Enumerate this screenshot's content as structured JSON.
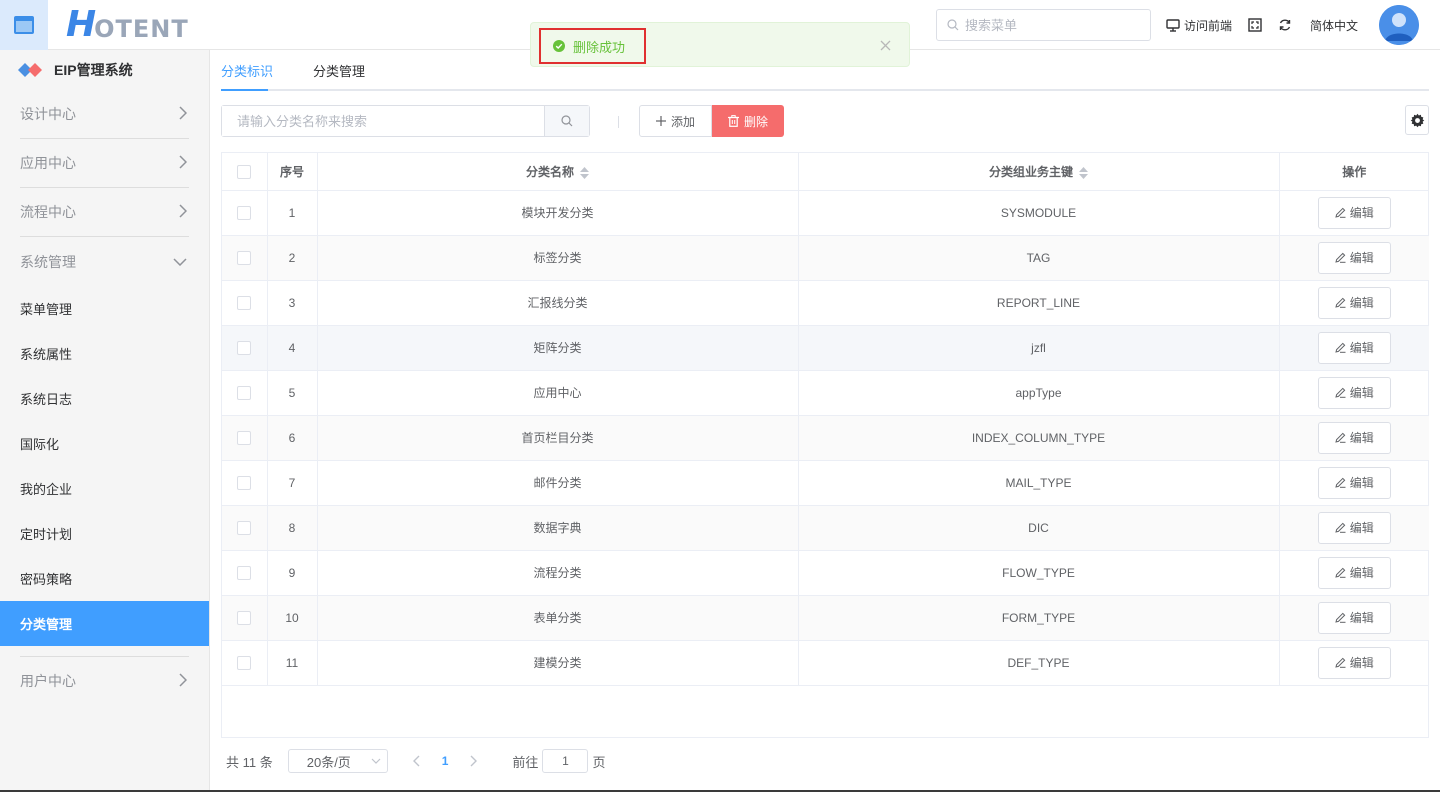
{
  "header": {
    "logo_big": "H",
    "logo_rest": "OTENT",
    "search_placeholder": "搜索菜单",
    "visit_frontend": "访问前端",
    "language": "简体中文"
  },
  "toast": {
    "message": "删除成功"
  },
  "sidebar": {
    "system_title": "EIP管理系统",
    "groups_top": [
      {
        "label": "设计中心"
      },
      {
        "label": "应用中心"
      },
      {
        "label": "流程中心"
      }
    ],
    "expanded_group": "系统管理",
    "items": [
      {
        "label": "菜单管理"
      },
      {
        "label": "系统属性"
      },
      {
        "label": "系统日志"
      },
      {
        "label": "国际化"
      },
      {
        "label": "我的企业"
      },
      {
        "label": "定时计划"
      },
      {
        "label": "密码策略"
      },
      {
        "label": "分类管理"
      }
    ],
    "bottom_group": "用户中心"
  },
  "tabs": [
    {
      "label": "分类标识"
    },
    {
      "label": "分类管理"
    }
  ],
  "toolbar": {
    "search_placeholder": "请输入分类名称来搜索",
    "add_label": "添加",
    "delete_label": "删除"
  },
  "table": {
    "headers": {
      "index": "序号",
      "name": "分类名称",
      "key": "分类组业务主键",
      "action": "操作"
    },
    "edit_label": "编辑",
    "rows": [
      {
        "index": "1",
        "name": "模块开发分类",
        "key": "SYSMODULE"
      },
      {
        "index": "2",
        "name": "标签分类",
        "key": "TAG"
      },
      {
        "index": "3",
        "name": "汇报线分类",
        "key": "REPORT_LINE"
      },
      {
        "index": "4",
        "name": "矩阵分类",
        "key": "jzfl"
      },
      {
        "index": "5",
        "name": "应用中心",
        "key": "appType"
      },
      {
        "index": "6",
        "name": "首页栏目分类",
        "key": "INDEX_COLUMN_TYPE"
      },
      {
        "index": "7",
        "name": "邮件分类",
        "key": "MAIL_TYPE"
      },
      {
        "index": "8",
        "name": "数据字典",
        "key": "DIC"
      },
      {
        "index": "9",
        "name": "流程分类",
        "key": "FLOW_TYPE"
      },
      {
        "index": "10",
        "name": "表单分类",
        "key": "FORM_TYPE"
      },
      {
        "index": "11",
        "name": "建模分类",
        "key": "DEF_TYPE"
      }
    ]
  },
  "pagination": {
    "total": "共 11 条",
    "page_size": "20条/页",
    "current_page": "1",
    "goto_label": "前往",
    "goto_value": "1",
    "page_unit": "页"
  }
}
